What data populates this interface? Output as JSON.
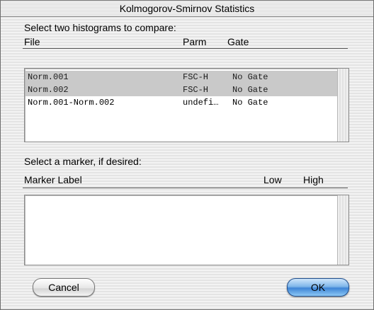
{
  "window": {
    "title": "Kolmogorov-Smirnov Statistics"
  },
  "histograms": {
    "prompt": "Select two histograms to compare:",
    "columns": {
      "file": "File",
      "parm": "Parm",
      "gate": "Gate"
    },
    "rows": [
      {
        "file": "Norm.001",
        "parm": "FSC-H",
        "gate": "No Gate",
        "selected": true
      },
      {
        "file": "Norm.002",
        "parm": "FSC-H",
        "gate": "No Gate",
        "selected": true
      },
      {
        "file": "Norm.001-Norm.002",
        "parm": "undefi…",
        "gate": "No Gate",
        "selected": false
      }
    ]
  },
  "markers": {
    "prompt": "Select a marker, if desired:",
    "columns": {
      "label": "Marker Label",
      "low": "Low",
      "high": "High"
    },
    "rows": []
  },
  "buttons": {
    "cancel": "Cancel",
    "ok": "OK"
  },
  "colors": {
    "selection": "#c9c9c9",
    "default_button": "#3f85d6"
  }
}
